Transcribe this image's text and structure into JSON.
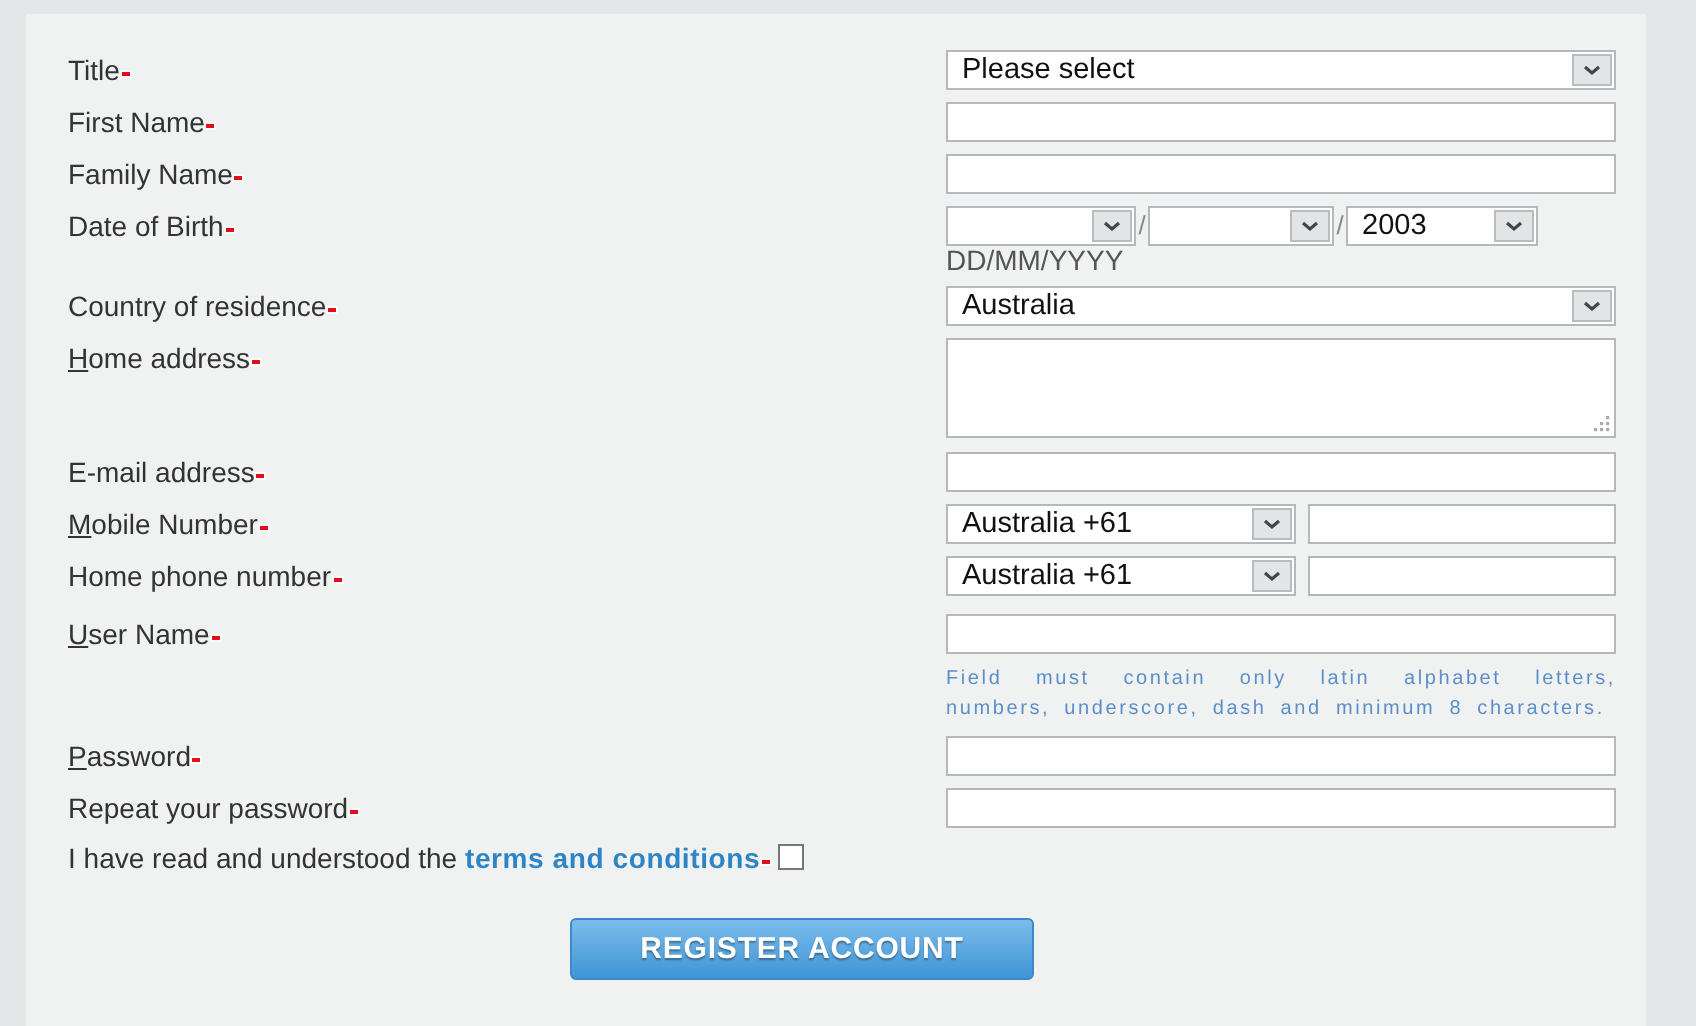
{
  "fields": [
    {
      "kind": "select",
      "label": "Title",
      "required": true,
      "underline_first": false,
      "value": "Please select"
    },
    {
      "kind": "text",
      "label": "First Name",
      "required": true,
      "underline_first": false
    },
    {
      "kind": "text",
      "label": "Family Name",
      "required": true,
      "underline_first": false
    },
    {
      "kind": "date",
      "label": "Date of Birth",
      "required": true,
      "underline_first": false,
      "parts": [
        {
          "kind": "day"
        },
        {
          "kind": "month"
        },
        {
          "kind": "year",
          "value": "2003"
        }
      ],
      "separators": [
        "/",
        "/"
      ],
      "hint": "DD/MM/YYYY"
    },
    {
      "kind": "select",
      "label": "Country of residence",
      "required": true,
      "underline_first": false,
      "value": "Australia"
    },
    {
      "kind": "textarea",
      "label": "Home address",
      "required": true,
      "underline_first": true
    },
    {
      "kind": "text",
      "label": "E-mail address",
      "required": true,
      "underline_first": false
    },
    {
      "kind": "phone",
      "label": "Mobile Number",
      "required": true,
      "underline_first": true,
      "value": "Australia +61"
    },
    {
      "kind": "phone",
      "label": "Home phone number",
      "required": true,
      "underline_first": false,
      "value": "Australia +61"
    },
    {
      "kind": "text",
      "label": "User Name",
      "required": true,
      "underline_first": true,
      "hint": "Field must contain only latin alphabet letters, numbers, underscore, dash and minimum 8 characters."
    },
    {
      "kind": "password",
      "label": "Password",
      "required": true,
      "underline_first": true
    },
    {
      "kind": "password",
      "label": "Repeat your password",
      "required": true,
      "underline_first": false
    }
  ],
  "terms": {
    "text": "I have read and understood the ",
    "link": "terms and conditions",
    "required": true,
    "checked": false
  },
  "submit": {
    "label": "REGISTER ACCOUNT"
  }
}
